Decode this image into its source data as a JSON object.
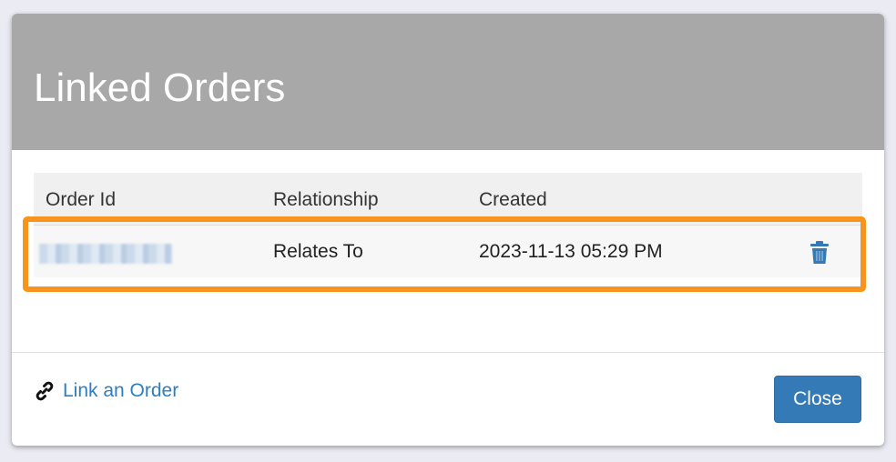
{
  "modal": {
    "title": "Linked Orders"
  },
  "table": {
    "headers": {
      "order_id": "Order Id",
      "relationship": "Relationship",
      "created": "Created"
    },
    "rows": [
      {
        "order_id": "",
        "relationship": "Relates To",
        "created": "2023-11-13 05:29 PM"
      }
    ]
  },
  "footer": {
    "link_label": "Link an Order",
    "close_label": "Close"
  },
  "colors": {
    "header_bg": "#a8a8a8",
    "highlight": "#f7941d",
    "primary": "#337ab7",
    "link": "#2d7ec2"
  },
  "icons": {
    "link": "link-icon",
    "delete": "trash-icon"
  }
}
